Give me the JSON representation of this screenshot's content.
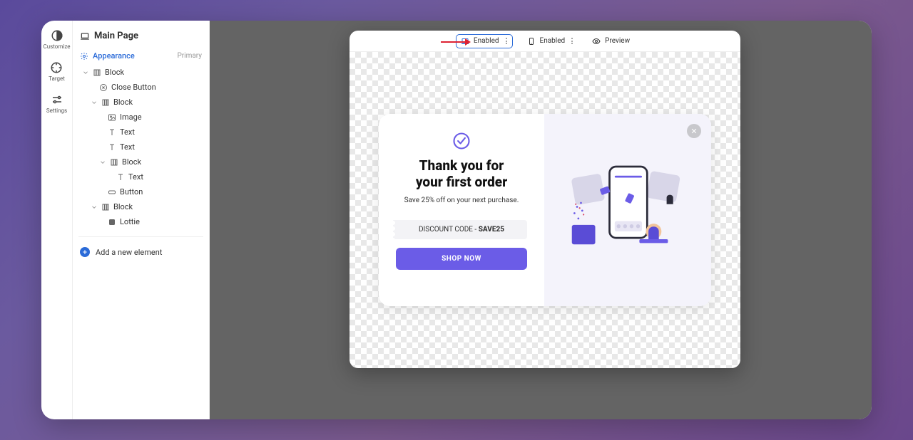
{
  "rail": {
    "customize": "Customize",
    "target": "Target",
    "settings": "Settings"
  },
  "sidebar": {
    "title": "Main Page",
    "appearance": {
      "label": "Appearance",
      "tag": "Primary"
    },
    "tree": {
      "block1": "Block",
      "close_button": "Close Button",
      "block2": "Block",
      "image": "Image",
      "text1": "Text",
      "text2": "Text",
      "block3": "Block",
      "text3": "Text",
      "button": "Button",
      "block4": "Block",
      "lottie": "Lottie"
    },
    "add": "Add a new element"
  },
  "toolbar": {
    "desktop": "Enabled",
    "mobile": "Enabled",
    "preview": "Preview"
  },
  "popup": {
    "heading_l1": "Thank you for",
    "heading_l2": "your first order",
    "sub": "Save 25% off on your next purchase.",
    "code_prefix": "DISCOUNT CODE - ",
    "code_value": "SAVE25",
    "cta": "SHOP NOW"
  }
}
